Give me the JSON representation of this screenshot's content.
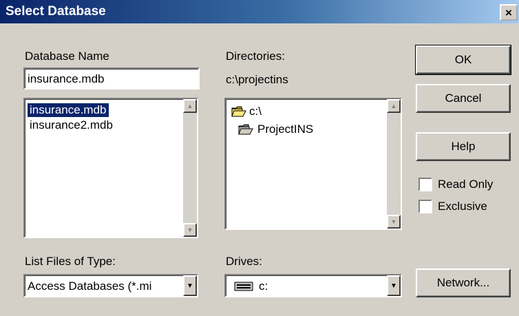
{
  "window": {
    "title": "Select Database",
    "close_glyph": "×"
  },
  "database_name": {
    "label": "Database Name",
    "value": "insurance.mdb"
  },
  "files": {
    "items": [
      "insurance.mdb",
      "insurance2.mdb"
    ],
    "selected_index": 0
  },
  "directories": {
    "label": "Directories:",
    "current_path": "c:\\projectins",
    "items": [
      {
        "label": "c:\\",
        "icon": "open-folder-icon"
      },
      {
        "label": "ProjectINS",
        "icon": "open-folder-icon"
      }
    ]
  },
  "buttons": {
    "ok": "OK",
    "cancel": "Cancel",
    "help": "Help",
    "network": "Network..."
  },
  "checkboxes": {
    "read_only": "Read Only",
    "exclusive": "Exclusive"
  },
  "file_type": {
    "label": "List Files of Type:",
    "value": "Access Databases (*.mi"
  },
  "drives": {
    "label": "Drives:",
    "value": "c:",
    "icon": "drive-icon"
  },
  "colors": {
    "title_start": "#0a246a",
    "title_end": "#a6caf0",
    "face": "#d4d0c8",
    "selection": "#0a246a"
  }
}
